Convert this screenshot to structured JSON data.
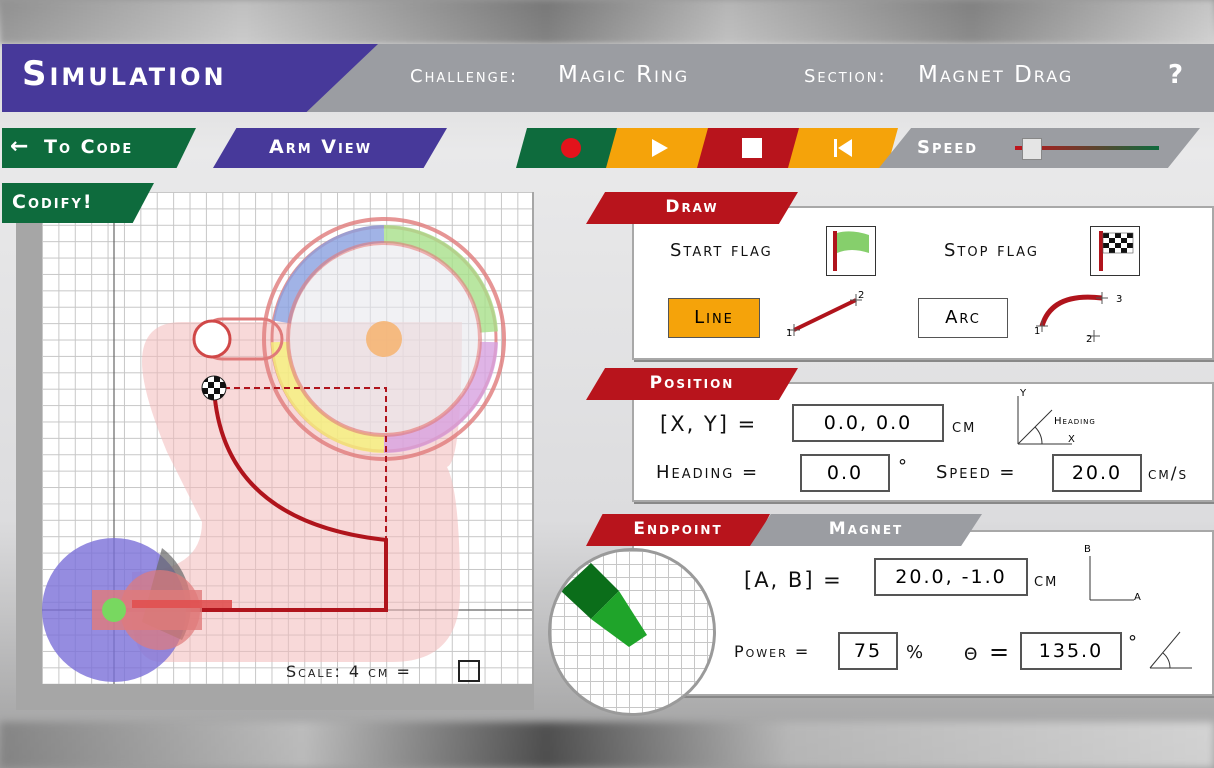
{
  "header": {
    "title": "Simulation",
    "challenge_label": "Challenge:",
    "challenge_value": "Magic Ring",
    "section_label": "Section:",
    "section_value": "Magnet Drag",
    "help": "?"
  },
  "toolbar": {
    "to_code": "To Code",
    "to_code_arrow": "←",
    "arm_view": "Arm View",
    "speed_label": "Speed",
    "speed_level": 0.05
  },
  "codify": "Codify!",
  "sim": {
    "scale_label": "Scale: 4 cm ="
  },
  "draw": {
    "tab": "Draw",
    "start_flag": "Start flag",
    "stop_flag": "Stop flag",
    "line": "Line",
    "arc": "Arc",
    "line_pts": [
      "1",
      "2"
    ],
    "arc_pts": [
      "1",
      "2",
      "3"
    ]
  },
  "position": {
    "tab": "Position",
    "xy_label": "[X, Y] =",
    "xy_value": "0.0,  0.0",
    "xy_unit": "cm",
    "heading_label": "Heading =",
    "heading_value": "0.0",
    "heading_unit": "°",
    "speed_label": "Speed =",
    "speed_value": "20.0",
    "speed_unit": "cm/s",
    "diagram_y": "Y",
    "diagram_x": "X",
    "diagram_heading": "Heading"
  },
  "endpoint": {
    "tab_endpoint": "Endpoint",
    "tab_magnet": "Magnet",
    "ab_label": "[A, B] =",
    "ab_value": "20.0, -1.0",
    "ab_unit": "cm",
    "power_label": "Power =",
    "power_value": "75",
    "power_unit": "%",
    "theta_label": "θ =",
    "theta_value": "135.0",
    "theta_unit": "°",
    "diagram_b": "B",
    "diagram_a": "A"
  },
  "colors": {
    "purple": "#47399a",
    "green": "#0e6b3d",
    "red": "#b8141c",
    "orange": "#f5a30a",
    "gray": "#9b9da2"
  }
}
